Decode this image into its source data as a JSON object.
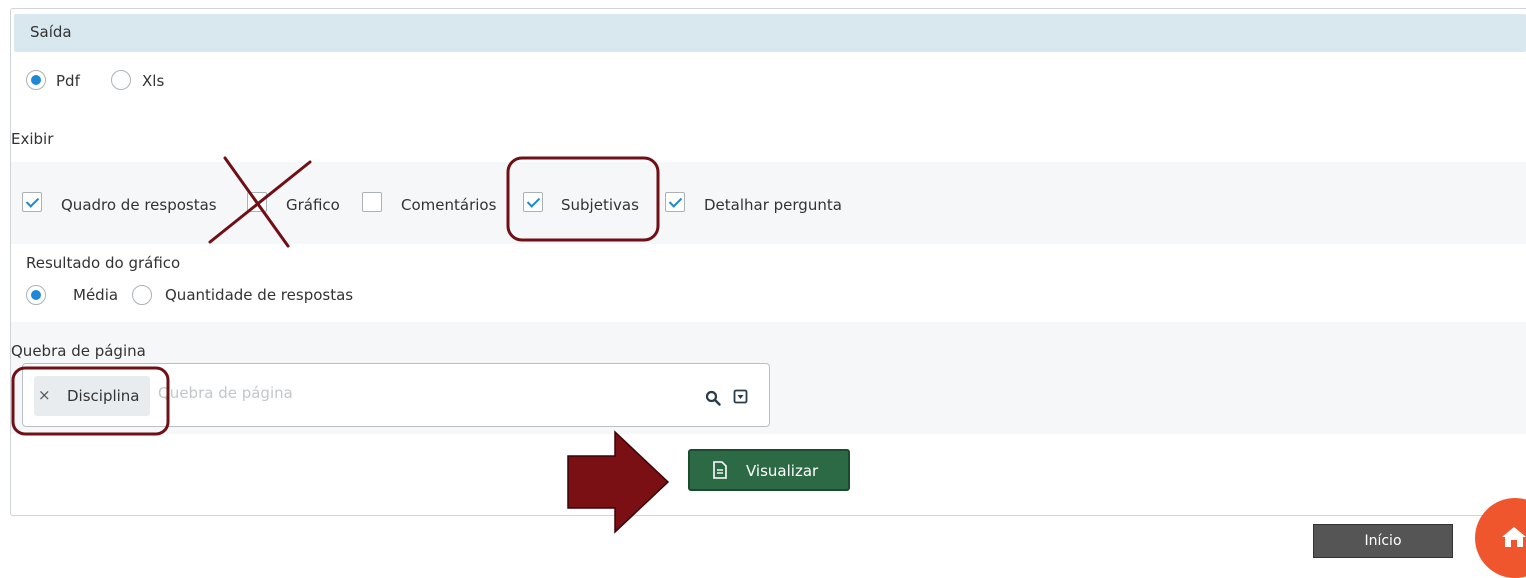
{
  "saida": {
    "title": "Saída",
    "options": [
      {
        "label": "Pdf",
        "selected": true
      },
      {
        "label": "Xls",
        "selected": false
      }
    ]
  },
  "exibir": {
    "title": "Exibir",
    "items": [
      {
        "label": "Quadro de respostas",
        "checked": true
      },
      {
        "label": "Gráfico",
        "checked": false
      },
      {
        "label": "Comentários",
        "checked": false
      },
      {
        "label": "Subjetivas",
        "checked": true
      },
      {
        "label": "Detalhar pergunta",
        "checked": true
      }
    ]
  },
  "resultado": {
    "title": "Resultado do gráfico",
    "options": [
      {
        "label": "Média",
        "selected": true
      },
      {
        "label": "Quantidade de respostas",
        "selected": false
      }
    ]
  },
  "quebra": {
    "title": "Quebra de página",
    "chip": "Disciplina",
    "chip_remove": "×",
    "placeholder": "Quebra de página"
  },
  "buttons": {
    "visualizar": "Visualizar",
    "inicio": "Início"
  },
  "colors": {
    "accent": "#1e88d6",
    "primary_button": "#2b6a44",
    "annotation": "#7a0f14",
    "home": "#f0562d"
  },
  "icons": {
    "search": "search-icon",
    "dropdown": "dropdown-icon",
    "document": "document-icon",
    "home": "home-icon"
  }
}
